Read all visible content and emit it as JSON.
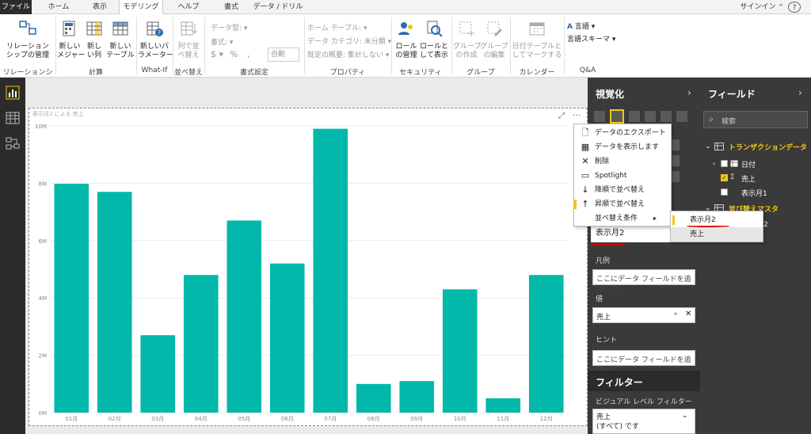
{
  "tabs": [
    "ファイル",
    "ホーム",
    "表示",
    "モデリング",
    "ヘルプ",
    "書式",
    "データ / ドリル"
  ],
  "signin": "サインイン",
  "help_label": "?",
  "ribbon": {
    "rel_manage": "リレーション\nシップの管理",
    "new_measure": "新しい\nメジャー",
    "new_column": "新し\nい列",
    "new_table": "新しい\nテーブル",
    "new_param": "新しいパ\nラメーター",
    "sort_by_col": "列で並\nべ替え",
    "data_type": "データ型:",
    "format": "書式:",
    "currency": "$",
    "percent": "%",
    "comma": ",",
    "auto": "自動",
    "home_table": "ホーム テーブル:",
    "data_category": "データ カテゴリ: 未分類",
    "default_summary": "既定の概要: 集計しない",
    "role_manage": "ロール\nの管理",
    "view_as_role": "ロールと\nして表示",
    "new_group": "グループ\nの作成",
    "edit_group": "グループ\nの編集",
    "mark_date_table": "日付テーブルと\nしてマークする",
    "language": "言語",
    "linguistic_schema": "言語スキーマ",
    "groups": [
      "リレーションシップ",
      "計算",
      "What-If",
      "並べ替え",
      "書式設定",
      "プロパティ",
      "セキュリティ",
      "グループ",
      "カレンダー",
      "Q&A"
    ]
  },
  "chart_header": "表示月2 による 売上",
  "chart_data": {
    "type": "bar",
    "categories": [
      "01月",
      "02月",
      "03月",
      "04月",
      "05月",
      "06月",
      "07月",
      "08月",
      "09月",
      "10月",
      "11月",
      "12月"
    ],
    "values": [
      7.98,
      7.7,
      2.7,
      4.8,
      6.7,
      5.2,
      9.9,
      1.0,
      1.1,
      4.3,
      0.5,
      4.8
    ],
    "ylim": [
      0,
      10
    ],
    "yticks": [
      "0M",
      "2M",
      "4M",
      "6M",
      "8M",
      "10M"
    ],
    "color": "#01b8aa",
    "xlabel": "",
    "ylabel": "",
    "grid": true
  },
  "visualization": {
    "title": "視覚化",
    "axis_value": "表示月2",
    "legend_label": "凡例",
    "legend_placeholder": "ここにデータ フィールドを追加して...",
    "value_label": "値",
    "value_field": "売上",
    "tooltip_label": "ヒント",
    "tooltip_placeholder": "ここにデータ フィールドを追加して...",
    "filters_title": "フィルター",
    "visual_filters": "ビジュアル レベル フィルター",
    "filter_field": "売上",
    "filter_value": "(すべて) です"
  },
  "fields": {
    "title": "フィールド",
    "search_placeholder": "検索",
    "table1": "トランザクションデータ",
    "table1_items": [
      "日付",
      "売上",
      "表示月1"
    ],
    "table2": "並び替えマスタ",
    "table2_item_partial": "2"
  },
  "context_menu": {
    "items": [
      "データのエクスポート",
      "データを表示します",
      "削除",
      "Spotlight",
      "降順で並べ替え",
      "昇順で並べ替え",
      "並べ替え条件"
    ],
    "submenu": [
      "表示月2",
      "売上"
    ]
  },
  "colors": {
    "accent": "#f2c811",
    "bar": "#01b8aa",
    "dark_panel": "#3a3a3a",
    "annotation": "#e00000"
  }
}
